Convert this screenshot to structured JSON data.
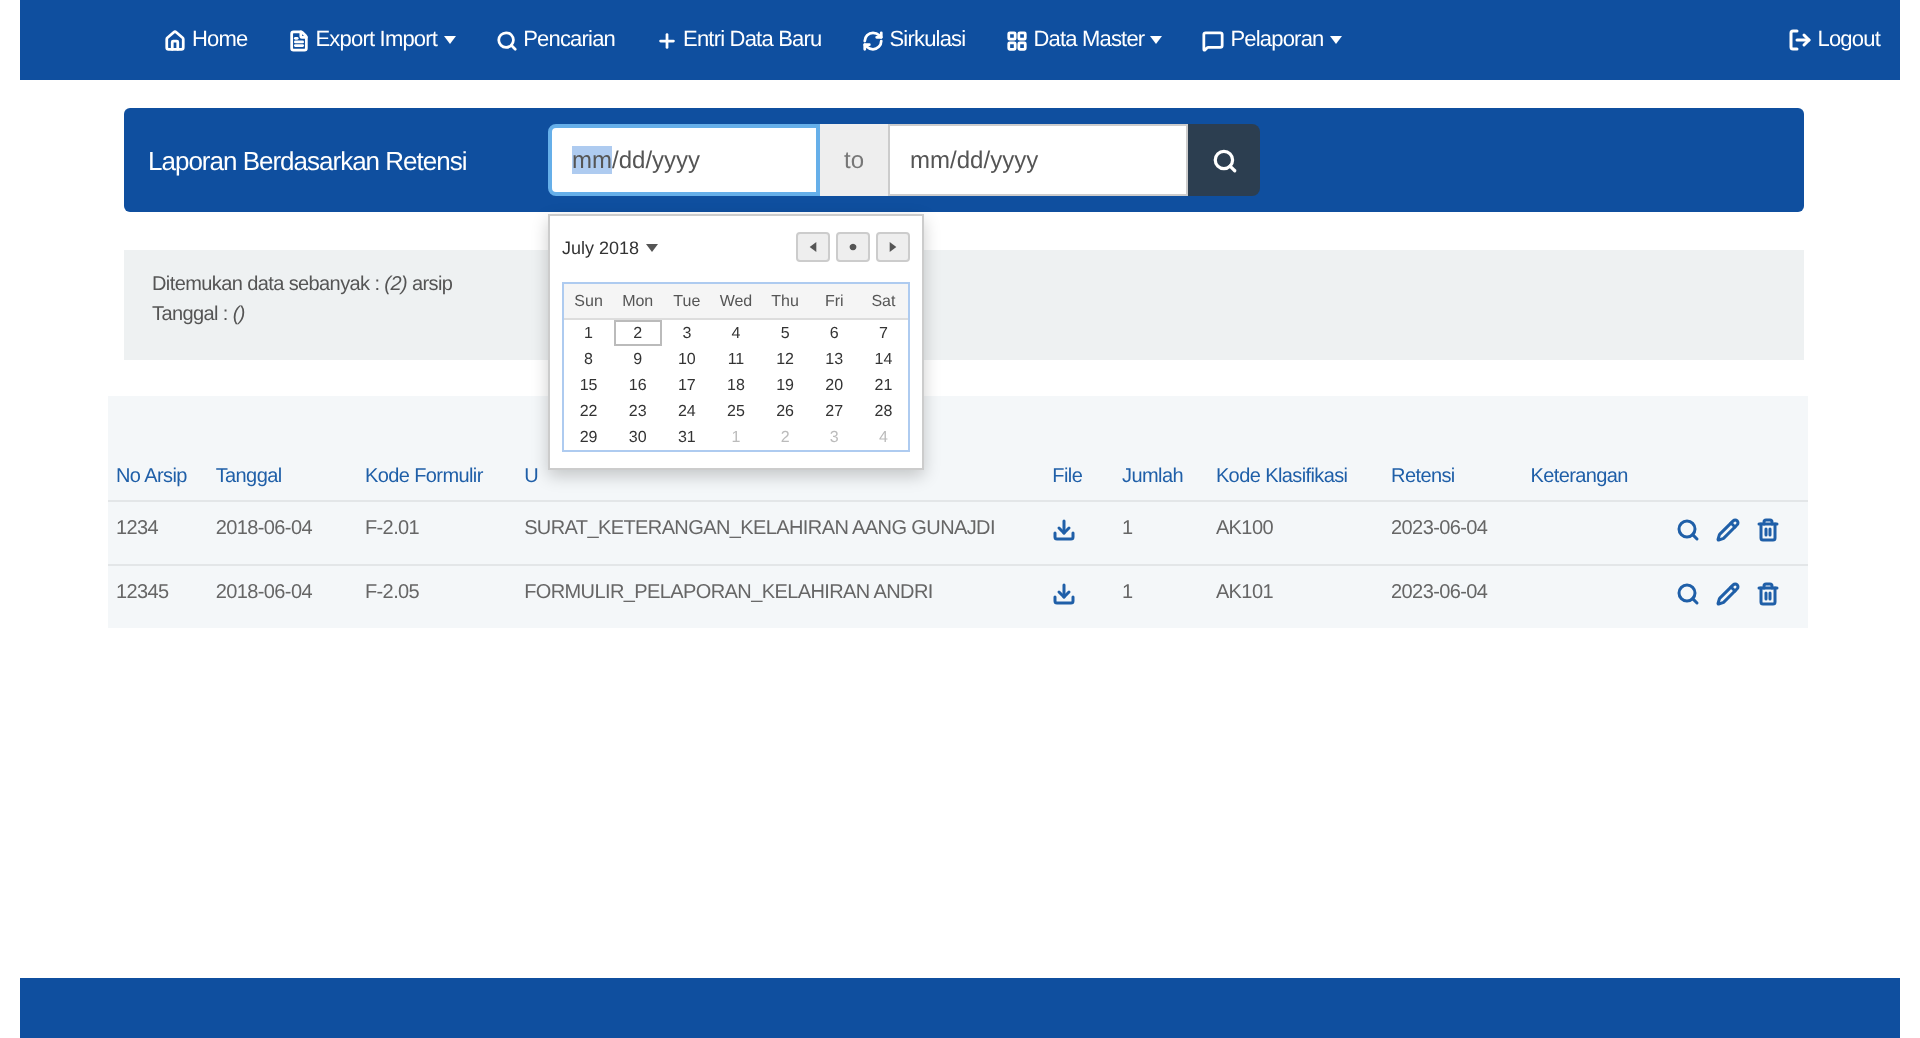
{
  "navbar": {
    "items": [
      {
        "label": "Home",
        "has_menu": false
      },
      {
        "label": "Export Import",
        "has_menu": true
      },
      {
        "label": "Pencarian",
        "has_menu": false
      },
      {
        "label": "Entri Data Baru",
        "has_menu": false
      },
      {
        "label": "Sirkulasi",
        "has_menu": false
      },
      {
        "label": "Data Master",
        "has_menu": true
      },
      {
        "label": "Pelaporan",
        "has_menu": true
      }
    ],
    "logout": {
      "label": "Logout"
    }
  },
  "report_bar": {
    "title": "Laporan Berdasarkan Retensi",
    "date_from": {
      "placeholder": "mm/dd/yyyy",
      "focused": true
    },
    "separator": "to",
    "date_to": {
      "placeholder": "mm/dd/yyyy",
      "focused": false
    }
  },
  "calendar": {
    "month": "July 2018",
    "weekdays": [
      "Sun",
      "Mon",
      "Tue",
      "Wed",
      "Thu",
      "Fri",
      "Sat"
    ],
    "weeks": [
      [
        {
          "label": "1",
          "muted": false,
          "selected": false
        },
        {
          "label": "2",
          "muted": false,
          "selected": true
        },
        {
          "label": "3",
          "muted": false,
          "selected": false
        },
        {
          "label": "4",
          "muted": false,
          "selected": false
        },
        {
          "label": "5",
          "muted": false,
          "selected": false
        },
        {
          "label": "6",
          "muted": false,
          "selected": false
        },
        {
          "label": "7",
          "muted": false,
          "selected": false
        }
      ],
      [
        {
          "label": "8",
          "muted": false,
          "selected": false
        },
        {
          "label": "9",
          "muted": false,
          "selected": false
        },
        {
          "label": "10",
          "muted": false,
          "selected": false
        },
        {
          "label": "11",
          "muted": false,
          "selected": false
        },
        {
          "label": "12",
          "muted": false,
          "selected": false
        },
        {
          "label": "13",
          "muted": false,
          "selected": false
        },
        {
          "label": "14",
          "muted": false,
          "selected": false
        }
      ],
      [
        {
          "label": "15",
          "muted": false,
          "selected": false
        },
        {
          "label": "16",
          "muted": false,
          "selected": false
        },
        {
          "label": "17",
          "muted": false,
          "selected": false
        },
        {
          "label": "18",
          "muted": false,
          "selected": false
        },
        {
          "label": "19",
          "muted": false,
          "selected": false
        },
        {
          "label": "20",
          "muted": false,
          "selected": false
        },
        {
          "label": "21",
          "muted": false,
          "selected": false
        }
      ],
      [
        {
          "label": "22",
          "muted": false,
          "selected": false
        },
        {
          "label": "23",
          "muted": false,
          "selected": false
        },
        {
          "label": "24",
          "muted": false,
          "selected": false
        },
        {
          "label": "25",
          "muted": false,
          "selected": false
        },
        {
          "label": "26",
          "muted": false,
          "selected": false
        },
        {
          "label": "27",
          "muted": false,
          "selected": false
        },
        {
          "label": "28",
          "muted": false,
          "selected": false
        }
      ],
      [
        {
          "label": "29",
          "muted": false,
          "selected": false
        },
        {
          "label": "30",
          "muted": false,
          "selected": false
        },
        {
          "label": "31",
          "muted": false,
          "selected": false
        },
        {
          "label": "1",
          "muted": true,
          "selected": false
        },
        {
          "label": "2",
          "muted": true,
          "selected": false
        },
        {
          "label": "3",
          "muted": true,
          "selected": false
        },
        {
          "label": "4",
          "muted": true,
          "selected": false
        }
      ]
    ]
  },
  "summary": {
    "found": "Ditemukan data sebanyak : *(2)* arsip",
    "date": "Tanggal : *()*"
  },
  "table": {
    "columns": [
      "No Arsip",
      "Tanggal",
      "Kode Formulir",
      "U",
      "File",
      "Jumlah",
      "Kode Klasifikasi",
      "Retensi",
      "Keterangan"
    ],
    "rows": [
      {
        "cells": [
          "1234",
          "2018-06-04",
          "F-2.01",
          "SURAT_KETERANGAN_KELAHIRAN AANG GUNAJDI",
          "",
          "1",
          "AK100",
          "2023-06-04",
          ""
        ]
      },
      {
        "cells": [
          "12345",
          "2018-06-04",
          "F-2.05",
          "FORMULIR_PELAPORAN_KELAHIRAN ANDRI",
          "",
          "1",
          "AK101",
          "2023-06-04",
          ""
        ]
      }
    ]
  }
}
